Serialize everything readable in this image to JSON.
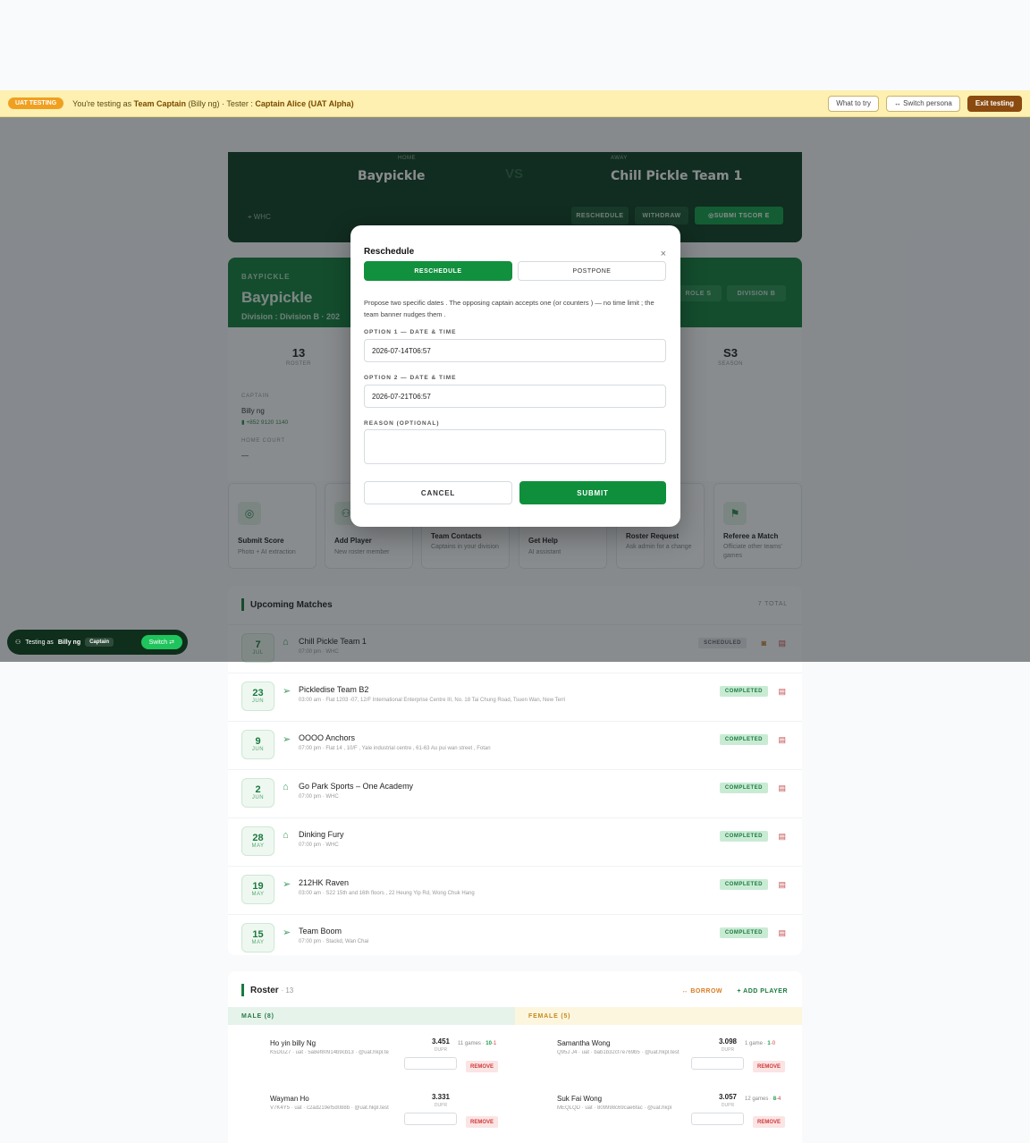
{
  "uat": {
    "pill": "UAT TESTING",
    "prefix": "You're testing as",
    "role": "Team Captain",
    "user": "(Billy ng)",
    "tester_prefix": "· Tester :",
    "tester": "Captain Alice (UAT Alpha)",
    "what_to_try": "What to try",
    "switch_persona": "↔ Switch persona",
    "exit": "Exit testing"
  },
  "hero": {
    "home_label": "HOME",
    "home_team": "Baypickle",
    "vs": "VS",
    "away_label": "AWAY",
    "away_team": "Chill Pickle Team 1",
    "location": "WHC",
    "btn_reschedule": "RESCHEDULE",
    "btn_withdraw": "WITHDRAW",
    "btn_submit": "SUBMI TSCOR E"
  },
  "team": {
    "overline": "BAYPICKLE",
    "name": "Baypickle",
    "division": "Division : Division B · 202",
    "chip_role": "ROLE S",
    "chip_division": "DIVISION B",
    "stat_roster_value": "13",
    "stat_roster_label": "ROSTER",
    "stat_season_value": "S3",
    "stat_season_label": "SEASON",
    "captain_label": "CAPTAIN",
    "captain_name": "Billy ng",
    "captain_phone": "+852 9120 1140",
    "home_court_label": "HOME COURT",
    "home_court_value": "—"
  },
  "actions": [
    {
      "title": "Submit Score",
      "desc": "Photo + AI extraction",
      "icon": "◎"
    },
    {
      "title": "Add Player",
      "desc": "New roster member",
      "icon": "⚇"
    },
    {
      "title": "Team Contacts",
      "desc": "Captains in your division",
      "icon": "☏"
    },
    {
      "title": "Get Help",
      "desc": "AI assistant",
      "icon": "?"
    },
    {
      "title": "Roster Request",
      "desc": "Ask admin for a change",
      "icon": "✎"
    },
    {
      "title": "Referee a Match",
      "desc": "Officiate other teams' games",
      "icon": "⚑"
    }
  ],
  "matches": {
    "title": "Upcoming Matches",
    "total": "7 TOTAL",
    "rows": [
      {
        "day": "7",
        "mon": "JUL",
        "icon": "⌂",
        "name": "Chill Pickle Team 1",
        "sub": "07:00 pm · WHC",
        "status": "SCHEDULED"
      },
      {
        "day": "23",
        "mon": "JUN",
        "icon": "➢",
        "name": "Pickledise Team B2",
        "sub": "03:00 am · Flat 1203 -07, 12/F International Enterprise Centre III, No. 18 Tai Chung Road, Tsuen Wan, New Terri",
        "status": "COMPLETED"
      },
      {
        "day": "9",
        "mon": "JUN",
        "icon": "➢",
        "name": "OOOO Anchors",
        "sub": "07:00 pm · Flat 14 , 10/F , Yale industrial centre , 61-63 Au pui wan street , Fotan",
        "status": "COMPLETED"
      },
      {
        "day": "2",
        "mon": "JUN",
        "icon": "⌂",
        "name": "Go Park Sports – One Academy",
        "sub": "07:00 pm · WHC",
        "status": "COMPLETED"
      },
      {
        "day": "28",
        "mon": "MAY",
        "icon": "⌂",
        "name": "Dinking Fury",
        "sub": "07:00 pm · WHC",
        "status": "COMPLETED"
      },
      {
        "day": "19",
        "mon": "MAY",
        "icon": "➢",
        "name": "212HK Raven",
        "sub": "03:00 am · S22 15th and 16th floors , 22 Heung Yip Rd, Wong Chuk Hang",
        "status": "COMPLETED"
      },
      {
        "day": "15",
        "mon": "MAY",
        "icon": "➢",
        "name": "Team Boom",
        "sub": "07:00 pm · Stackd, Wan Chai",
        "status": "COMPLETED"
      }
    ]
  },
  "roster": {
    "title": "Roster",
    "count": "· 13",
    "borrow": "↔ BORROW",
    "add": "+ ADD PLAYER",
    "male_head": "MALE (8)",
    "female_head": "FEMALE (5)",
    "dupr_label": "DUPR",
    "remove": "REMOVE",
    "male": [
      {
        "name": "Ho yin billy Ng",
        "id": "K5DGZ7 · uat · 5a8ef80914b9cb13 · @uat.hkpl.te",
        "dupr": "3.451",
        "games": "11 games ·",
        "w": "10",
        "l": "1"
      },
      {
        "name": "Wayman Ho",
        "id": "V7K4Y5 · uat · c2ad219ef5d088b · @uat.hkpl.test",
        "dupr": "3.331",
        "games": "",
        "w": "",
        "l": ""
      }
    ],
    "female": [
      {
        "name": "Samantha Wong",
        "id": "Q95J J4 · uat · bab1b32cf7e769b5 · @uat.hkpl.test",
        "dupr": "3.098",
        "games": "1 game ·",
        "w": "1",
        "l": "0"
      },
      {
        "name": "Suk Fai Wong",
        "id": "MEQLQD · uat · 809998c69cae6fac · @uat.hkpl",
        "dupr": "3.057",
        "games": "12 games ·",
        "w": "8",
        "l": "4"
      }
    ]
  },
  "switcher": {
    "label": "Testing as",
    "user": "Billy ng",
    "role": "Captain",
    "btn": "Switch ⇄"
  },
  "modal": {
    "title": "Reschedule",
    "close": "×",
    "tab_reschedule": "RESCHEDULE",
    "tab_postpone": "POSTPONE",
    "desc": "Propose two specific dates . The opposing captain accepts one (or counters ) — no time limit ; the team banner nudges them .",
    "opt1_label": "OPTION 1 — DATE & TIME",
    "opt1_value": "2026-07-14T06:57",
    "opt2_label": "OPTION 2 — DATE & TIME",
    "opt2_value": "2026-07-21T06:57",
    "reason_label": "REASON (OPTIONAL)",
    "reason_value": "",
    "cancel": "CANCEL",
    "submit": "SUBMIT"
  }
}
